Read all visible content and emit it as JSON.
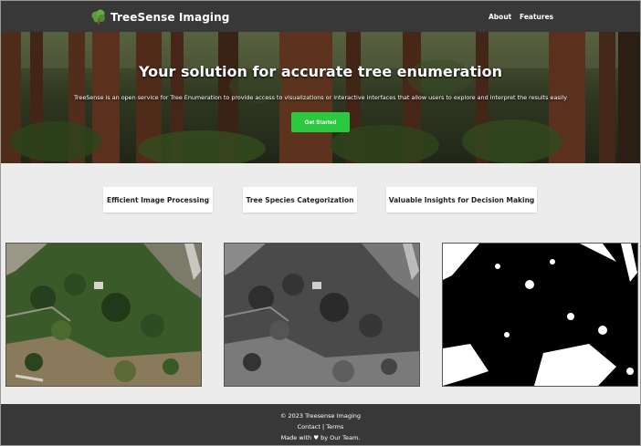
{
  "navbar": {
    "brand": "TreeSense Imaging",
    "brand_icon": "tree-icon",
    "links": [
      "About",
      "Features"
    ]
  },
  "hero": {
    "title": "Your solution for accurate tree enumeration",
    "subtitle": "TreeSense is an open service for Tree Enumeration to provide access to visualizations or interactive interfaces that allow users to explore and interpret the results easily",
    "cta_label": "Get Started"
  },
  "features": [
    "Efficient Image Processing",
    "Tree Species Categorization",
    "Valuable Insights for Decision Making"
  ],
  "footer": {
    "copyright": "© 2023 Treesense Imaging",
    "contact": "Contact",
    "separator": "|",
    "terms": "Terms",
    "made_with": "Made with ♥ by Our Team."
  },
  "colors": {
    "navbar_bg": "#383838",
    "cta_bg": "#2bc940",
    "page_bg": "#ececec",
    "brand_icon": "#5a9a3a"
  }
}
